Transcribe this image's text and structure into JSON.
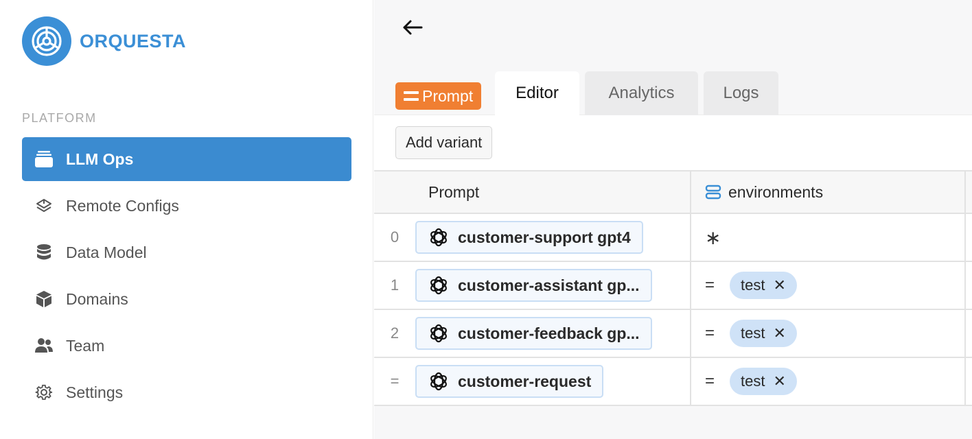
{
  "brand": {
    "name": "ORQUESTA",
    "color": "#3b8fd6"
  },
  "sidebar": {
    "section_label": "PLATFORM",
    "items": [
      {
        "label": "LLM Ops",
        "icon": "stack-icon",
        "active": true
      },
      {
        "label": "Remote Configs",
        "icon": "layers-icon",
        "active": false
      },
      {
        "label": "Data Model",
        "icon": "database-icon",
        "active": false
      },
      {
        "label": "Domains",
        "icon": "cube-icon",
        "active": false
      },
      {
        "label": "Team",
        "icon": "users-icon",
        "active": false
      },
      {
        "label": "Settings",
        "icon": "gear-icon",
        "active": false
      }
    ]
  },
  "header": {
    "back_icon": "arrow-left-icon"
  },
  "tabs": {
    "type_badge": "Prompt",
    "items": [
      {
        "label": "Editor",
        "active": true
      },
      {
        "label": "Analytics",
        "active": false
      },
      {
        "label": "Logs",
        "active": false
      }
    ]
  },
  "toolbar": {
    "add_variant_label": "Add variant"
  },
  "table": {
    "columns": {
      "prompt": "Prompt",
      "environments": "environments"
    },
    "rows": [
      {
        "index": "0",
        "prompt": "customer-support gpt4",
        "env_op": "",
        "env_any": "∗",
        "env_tag": ""
      },
      {
        "index": "1",
        "prompt": "customer-assistant gp...",
        "env_op": "=",
        "env_any": "",
        "env_tag": "test"
      },
      {
        "index": "2",
        "prompt": "customer-feedback gp...",
        "env_op": "=",
        "env_any": "",
        "env_tag": "test"
      },
      {
        "index": "=",
        "prompt": "customer-request",
        "env_op": "=",
        "env_any": "",
        "env_tag": "test"
      }
    ],
    "remove_glyph": "✕"
  },
  "colors": {
    "accent": "#3b8bd0",
    "badge": "#f07f32",
    "tag": "#cfe2f7"
  }
}
